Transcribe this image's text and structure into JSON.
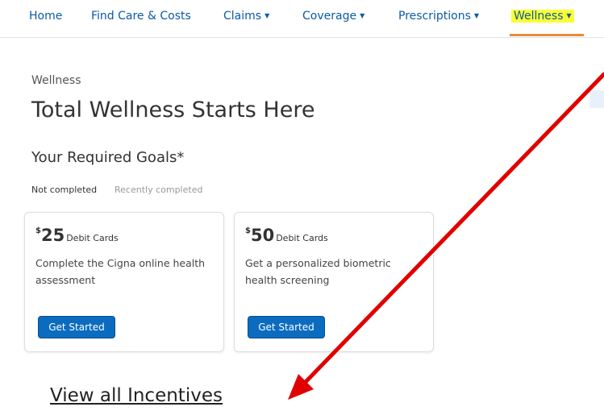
{
  "nav": {
    "items": [
      {
        "label": "Home",
        "caret": ""
      },
      {
        "label": "Find Care & Costs",
        "caret": ""
      },
      {
        "label": "Claims",
        "caret": "▼"
      },
      {
        "label": "Coverage",
        "caret": "▼"
      },
      {
        "label": "Prescriptions",
        "caret": "▼"
      },
      {
        "label": "Wellness",
        "caret": "▼"
      }
    ],
    "active": "Wellness"
  },
  "breadcrumb": "Wellness",
  "page_title": "Total Wellness Starts Here",
  "section_title": "Your Required Goals*",
  "tabs": [
    {
      "label": "Not completed",
      "selected": true
    },
    {
      "label": "Recently completed",
      "selected": false
    }
  ],
  "cards": [
    {
      "currency": "$",
      "amount": "25",
      "unit": "Debit Cards",
      "description": "Complete the Cigna online health assessment",
      "button_label": "Get Started"
    },
    {
      "currency": "$",
      "amount": "50",
      "unit": "Debit Cards",
      "description": "Get a personalized biometric health screening",
      "button_label": "Get Started"
    }
  ],
  "incentives_link": "View all Incentives",
  "colors": {
    "link_blue": "#0b5aa6",
    "button_blue": "#0b6cbf",
    "highlight_yellow": "#fbff33",
    "active_underline": "#e88a3c",
    "annotation_arrow": "#e00000"
  }
}
